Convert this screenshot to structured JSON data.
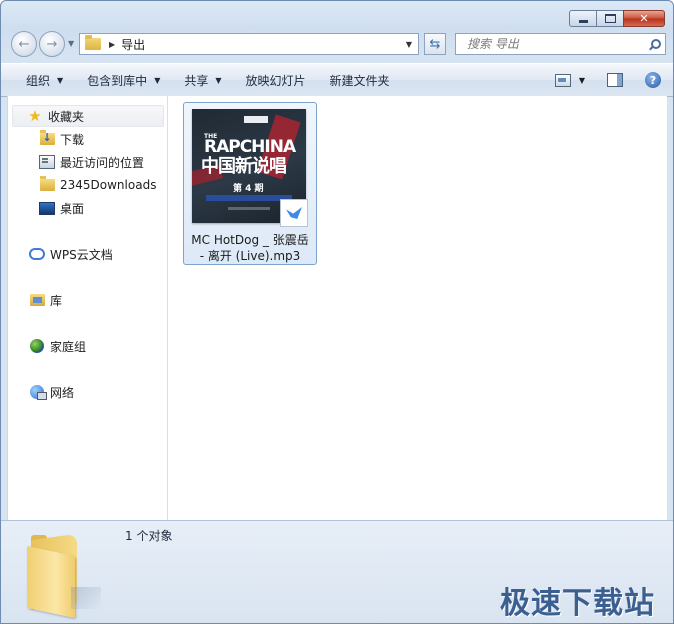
{
  "window": {
    "caption": {
      "minimize_icon": "minimize-icon",
      "maximize_icon": "maximize-icon",
      "close_icon": "close-icon"
    }
  },
  "navigation": {
    "back_icon": "back-arrow-icon",
    "forward_icon": "forward-arrow-icon",
    "address": {
      "crumb": "导出"
    },
    "refresh_icon": "refresh-icon",
    "search": {
      "placeholder": "搜索 导出"
    }
  },
  "toolbar": {
    "organize": "组织",
    "include_in_library": "包含到库中",
    "share": "共享",
    "slideshow": "放映幻灯片",
    "new_folder": "新建文件夹",
    "view_icon": "view-options-icon",
    "preview_pane_icon": "preview-pane-icon",
    "help_icon": "help-icon",
    "help_glyph": "?"
  },
  "sidebar": {
    "favorites": "收藏夹",
    "favorites_items": [
      "下载",
      "最近访问的位置",
      "2345Downloads",
      "桌面"
    ],
    "wps_cloud": "WPS云文档",
    "libraries": "库",
    "homegroup": "家庭组",
    "network": "网络"
  },
  "files": [
    {
      "name_line1": "MC HotDog _ 张震岳",
      "name_line2": "- 离开 (Live).mp3",
      "thumbnail": {
        "the": "THE",
        "title": "RAPCHINA",
        "subtitle": "中国新说唱",
        "episode": "第 4 期"
      }
    }
  ],
  "details": {
    "count": "1 个对象"
  },
  "watermark": "极速下载站",
  "colors": {
    "accent": "#3c5f91",
    "selection_border": "#7da2ce"
  }
}
